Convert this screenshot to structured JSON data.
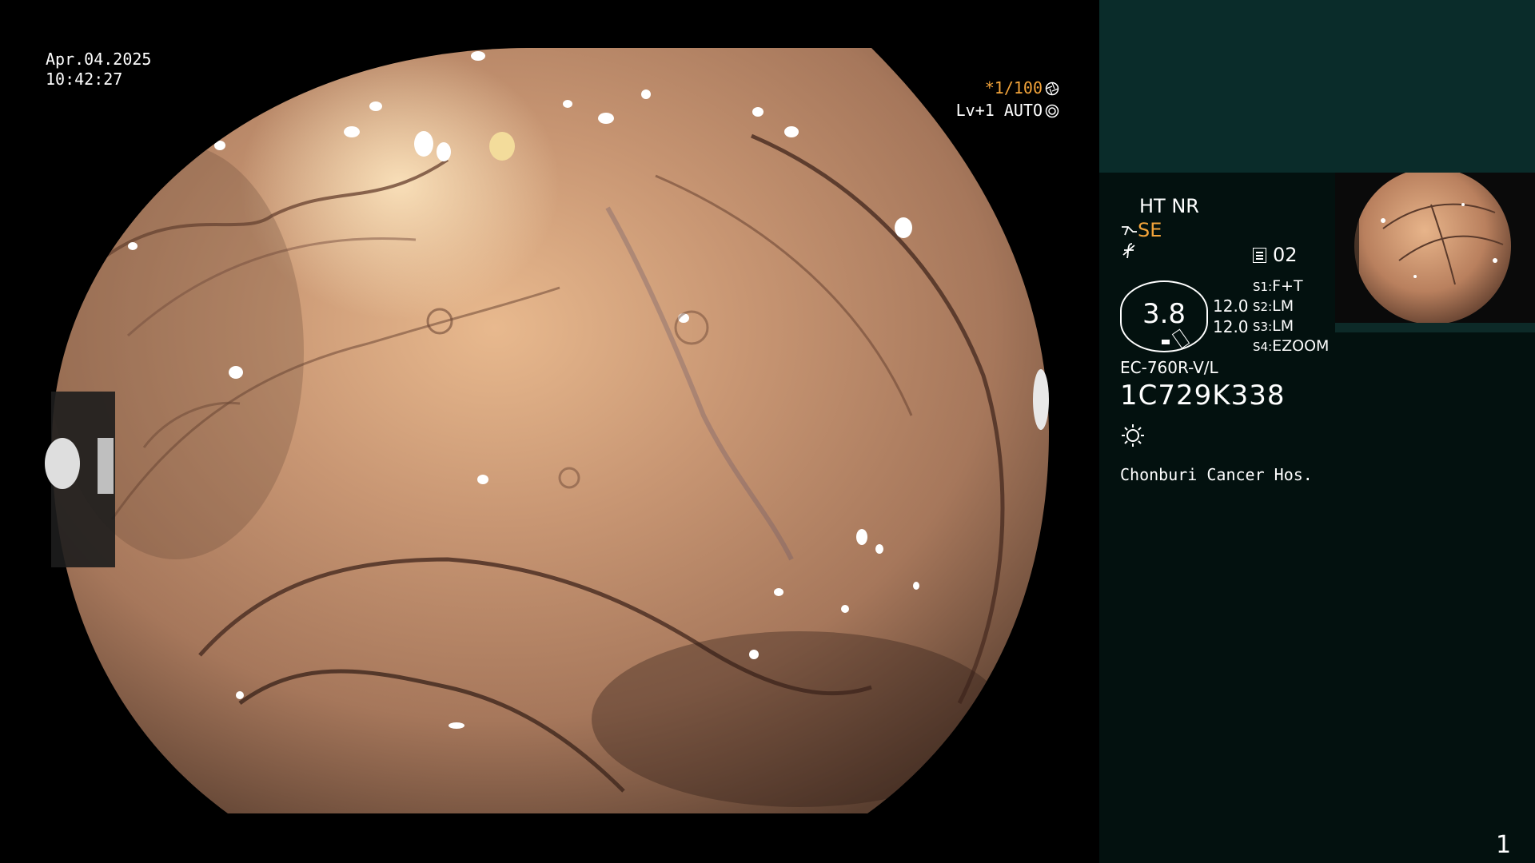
{
  "osd": {
    "date": "Apr.04.2025",
    "time": "10:42:27",
    "shutter": "*1/100",
    "level": "Lv+1 AUTO"
  },
  "panel": {
    "ht_nr": "HT NR",
    "se_label": "SE",
    "memo": "02",
    "oval_value": "3.8",
    "value_1": "12.0",
    "value_2": "12.0",
    "switches": [
      {
        "key": "S1:",
        "value": "F+T"
      },
      {
        "key": "S2:",
        "value": "LM"
      },
      {
        "key": "S3:",
        "value": "LM"
      },
      {
        "key": "S4:",
        "value": "EZOOM"
      }
    ],
    "scope_model": "EC-760R-V/L",
    "serial": "1C729K338",
    "hospital": "Chonburi Cancer Hos.",
    "page_number": "1"
  },
  "icons": {
    "shutter": "aperture-icon",
    "level": "iris-icon",
    "se": "scope-tip-icon",
    "f": "freeze-icon",
    "memo": "memo-icon",
    "light": "sun-icon"
  },
  "colors": {
    "accent": "#f2a33a",
    "panel_top": "#0a2c2a",
    "panel": "#03110f"
  }
}
